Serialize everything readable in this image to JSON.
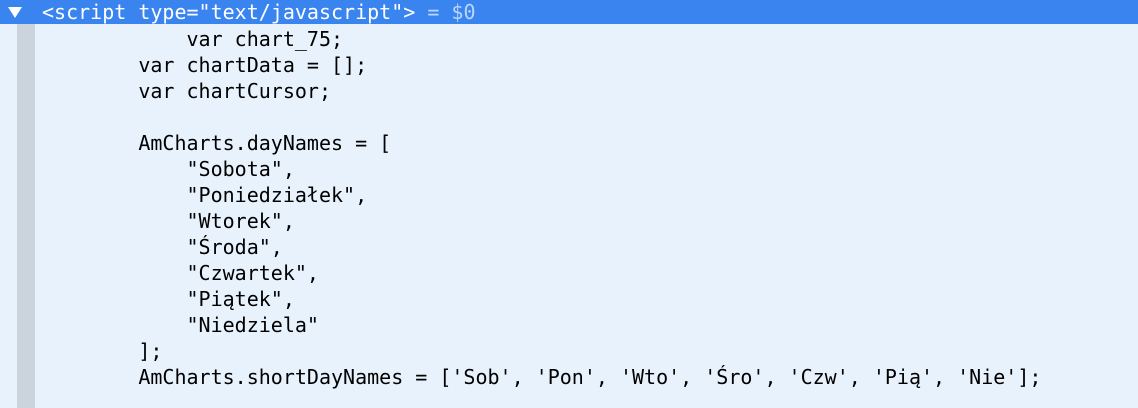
{
  "selected_node": {
    "tag_text": "<script type=\"text/javascript\">",
    "separator": " = ",
    "console_ref": "$0",
    "expander_icon": "disclosure-triangle-down-icon"
  },
  "colors": {
    "selection_background": "#3a84f0",
    "panel_background": "#e8f2fd",
    "gutter": "#cbd3dc",
    "code_text": "#000000"
  },
  "code_lines": [
    "            var chart_75;",
    "        var chartData = [];",
    "        var chartCursor;",
    "",
    "        AmCharts.dayNames = [",
    "            \"Sobota\",",
    "            \"Poniedziałek\",",
    "            \"Wtorek\",",
    "            \"Środa\",",
    "            \"Czwartek\",",
    "            \"Piątek\",",
    "            \"Niedziela\"",
    "        ];",
    "        AmCharts.shortDayNames = ['Sob', 'Pon', 'Wto', 'Śro', 'Czw', 'Pią', 'Nie'];"
  ]
}
